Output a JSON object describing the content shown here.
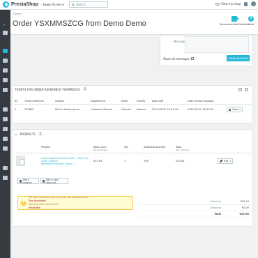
{
  "header": {
    "logo": "PrestaShop",
    "version": "1.7.6.1",
    "quick_access": "Quick Access ▾",
    "search_placeholder": "Search",
    "view_shop": "View my shop"
  },
  "page": {
    "breadcrumb": "Orders",
    "title": "Order YSXMMSZCG from Demo Demo",
    "toolbar": {
      "recommended": "Recommended Modules",
      "help": "Help"
    }
  },
  "message_card": {
    "message_label": "Message",
    "show_all": "Show all messages",
    "send": "SEND MESSAGE"
  },
  "tickets": {
    "title": "TICKETS FOR ORDER REFERENCE YSXMMSZCG",
    "count": "1",
    "columns": [
      "ID",
      "Ticket reference",
      "Subject",
      "Department",
      "State",
      "Priority",
      "Date add",
      "Date of last message"
    ],
    "rows": [
      {
        "id": "1",
        "reference": "783899",
        "subject": "Who is Lorem Ipsum",
        "department": "Customer Service",
        "state": "Opened",
        "priority": "Normal",
        "date_add": "2019-08-22 18:21:44",
        "date_last": "2019-08-22 18:25:03",
        "action": "View"
      }
    ]
  },
  "products": {
    "title": "PRODUCTS",
    "count": "1",
    "columns": {
      "product": "Product",
      "base_price": "Base price",
      "base_price_sub": "Tax excluded",
      "qty": "Qty",
      "available": "Available quantity",
      "total": "Total",
      "total_sub": "Tax included"
    },
    "rows": [
      {
        "name_line1": "Hummingbird printed t-shirt - Taille (S) - Color : Blanco",
        "name_line2": "Reference number: demo_1",
        "base_price": "€22.94",
        "qty": "1",
        "available": "299",
        "total": "€22.94",
        "action": "Edit"
      }
    ],
    "add_product": "Add a product",
    "add_discount": "Add a new discount"
  },
  "alert": {
    "line1_prefix": "For this customer group, prices are displayed as:",
    "line1_value": "Tax included",
    "line2_prefix": "Merchandise returns are",
    "line2_value": "disabled"
  },
  "totals": {
    "products_label": "Products",
    "products_value": "€22.94",
    "shipping_label": "Shipping",
    "shipping_value": "€0.00",
    "total_label": "Total",
    "total_value": "€22.94"
  },
  "colors": {
    "accent": "#25b9d7",
    "sidebar": "#363a41",
    "warning": "#fcc94f"
  }
}
